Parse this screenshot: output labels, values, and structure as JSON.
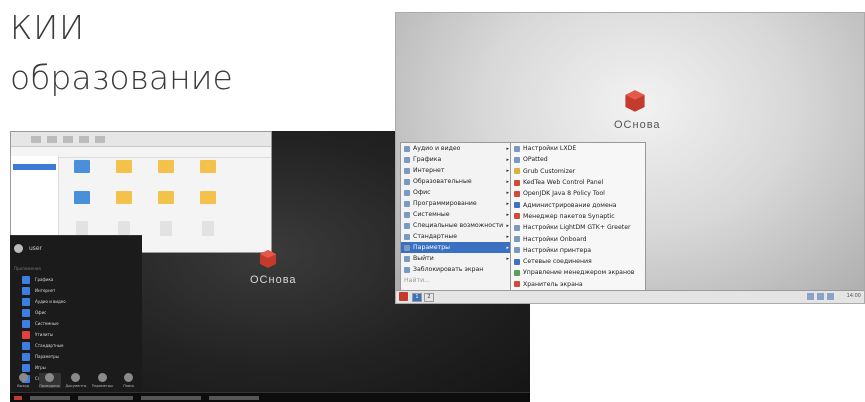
{
  "heading": {
    "line1": "КИИ",
    "line2": "образование"
  },
  "dark_screen": {
    "brand": "ОСнова",
    "start_menu": {
      "user": "user",
      "section": "Приложения",
      "items": [
        "Графика",
        "Интернет",
        "Аудио и видео",
        "Офис",
        "Системные",
        "Утилиты",
        "Стандартные",
        "Параметры",
        "Игры",
        "Справка"
      ],
      "bottom": [
        "Выход",
        "Проводник",
        "Документы",
        "Параметры",
        "Поиск"
      ]
    }
  },
  "light_screen": {
    "brand": "ОСнова",
    "menu": {
      "items": [
        "Аудио и видео",
        "Графика",
        "Интернет",
        "Образовательные",
        "Офис",
        "Программирование",
        "Системные",
        "Специальные возможности",
        "Стандартные",
        "Параметры",
        "Выйти",
        "Заблокировать экран",
        "Найти..."
      ],
      "selected": "Параметры"
    },
    "submenu": [
      "Настройки LXDE",
      "OPatted",
      "Grub Customizer",
      "KedTea Web Control Panel",
      "OpenJDK Java 8 Policy Tool",
      "Администрирование домена",
      "Менеджер пакетов Synaptic",
      "Настройки LightDM GTK+ Greeter",
      "Настройки Onboard",
      "Настройки принтера",
      "Сетевые соединения",
      "Управление менеджером экранов",
      "Хранитель экрана"
    ],
    "panel": {
      "workspaces": [
        "1",
        "2"
      ],
      "clock": "14:00"
    }
  },
  "colors": {
    "accent_red": "#c43a2c",
    "menu_select": "#3b6fc0"
  }
}
